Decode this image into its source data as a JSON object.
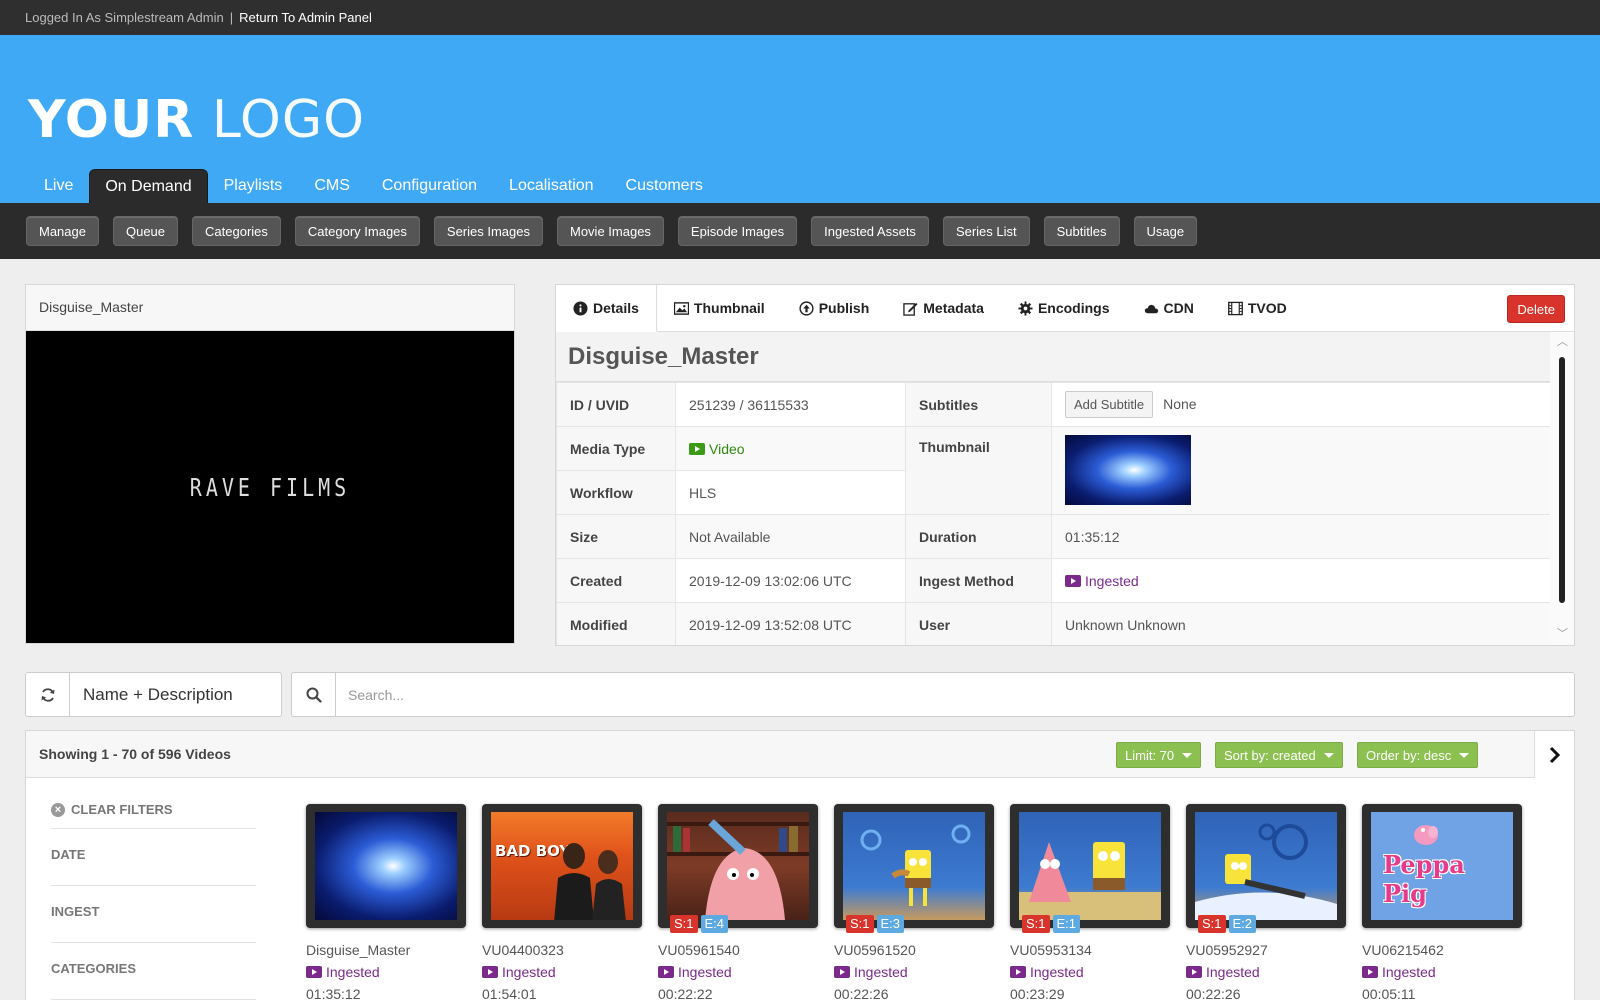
{
  "admin_bar": {
    "logged_in": "Logged In As Simplestream Admin",
    "separator": "|",
    "return_link": "Return To Admin Panel"
  },
  "logo": {
    "bold": "YOUR",
    "thin": "LOGO"
  },
  "main_nav": [
    "Live",
    "On Demand",
    "Playlists",
    "CMS",
    "Configuration",
    "Localisation",
    "Customers"
  ],
  "sub_nav": [
    "Manage",
    "Queue",
    "Categories",
    "Category Images",
    "Series Images",
    "Movie Images",
    "Episode Images",
    "Ingested Assets",
    "Series List",
    "Subtitles",
    "Usage"
  ],
  "player": {
    "title": "Disguise_Master",
    "brand": "RAVE FILMS"
  },
  "details": {
    "tabs": [
      "Details",
      "Thumbnail",
      "Publish",
      "Metadata",
      "Encodings",
      "CDN",
      "TVOD"
    ],
    "delete_label": "Delete",
    "heading": "Disguise_Master",
    "rows": {
      "id_label": "ID / UVID",
      "id_value": "251239 / 36115533",
      "subtitles_label": "Subtitles",
      "add_subtitle": "Add Subtitle",
      "subtitles_value": "None",
      "media_type_label": "Media Type",
      "media_type_value": "Video",
      "thumbnail_label": "Thumbnail",
      "workflow_label": "Workflow",
      "workflow_value": "HLS",
      "size_label": "Size",
      "size_value": "Not Available",
      "duration_label": "Duration",
      "duration_value": "01:35:12",
      "created_label": "Created",
      "created_value": "2019-12-09 13:02:06 UTC",
      "ingest_label": "Ingest Method",
      "ingest_value": "Ingested",
      "modified_label": "Modified",
      "modified_value": "2019-12-09 13:52:08 UTC",
      "user_label": "User",
      "user_value": "Unknown Unknown"
    }
  },
  "search": {
    "scope": "Name + Description",
    "placeholder": "Search..."
  },
  "results": {
    "showing": "Showing 1 - 70 of 596 Videos",
    "limit": "Limit: 70",
    "sort": "Sort by: created",
    "order": "Order by: desc",
    "filters": [
      "CLEAR FILTERS",
      "DATE",
      "INGEST",
      "CATEGORIES"
    ],
    "items": [
      {
        "id": "Disguise_Master",
        "status": "Ingested",
        "duration": "01:35:12"
      },
      {
        "id": "VU04400323",
        "status": "Ingested",
        "duration": "01:54:01",
        "overlay": "BAD BOYS"
      },
      {
        "id": "VU05961540",
        "status": "Ingested",
        "duration": "00:22:22",
        "season": "S:1",
        "episode": "E:4"
      },
      {
        "id": "VU05961520",
        "status": "Ingested",
        "duration": "00:22:26",
        "season": "S:1",
        "episode": "E:3"
      },
      {
        "id": "VU05953134",
        "status": "Ingested",
        "duration": "00:23:29",
        "season": "S:1",
        "episode": "E:1"
      },
      {
        "id": "VU05952927",
        "status": "Ingested",
        "duration": "00:22:26",
        "season": "S:1",
        "episode": "E:2"
      },
      {
        "id": "VU06215462",
        "status": "Ingested",
        "duration": "00:05:11",
        "overlay": "Peppa Pig"
      }
    ]
  },
  "colors": {
    "header_blue": "#3fa9f5",
    "dark_bar": "#2b2b2b",
    "delete_red": "#d9342b",
    "green_dropdown": "#8cc152",
    "ingested_purple": "#7b2a8c"
  }
}
